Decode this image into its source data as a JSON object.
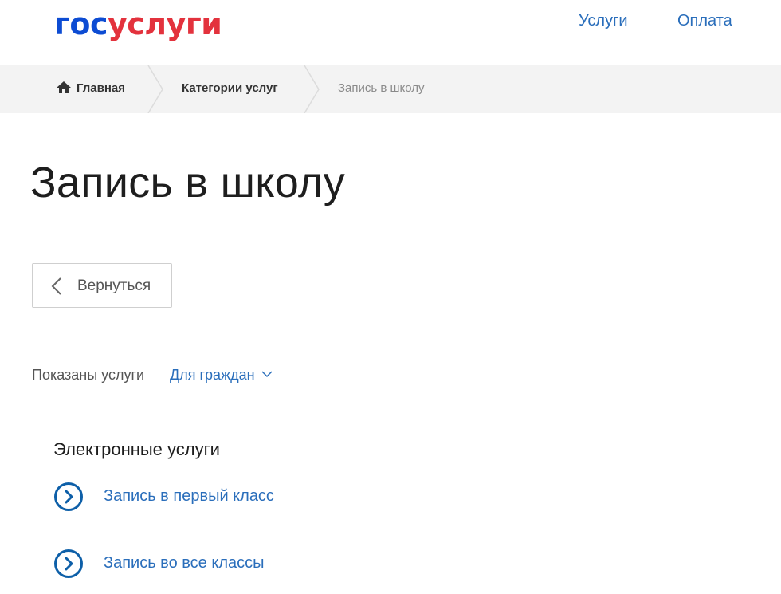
{
  "logo": {
    "part1": "гос",
    "part2": "услуги"
  },
  "top_nav": [
    {
      "label": "Услуги"
    },
    {
      "label": "Оплата"
    }
  ],
  "breadcrumbs": [
    {
      "label": "Главная",
      "icon": "home-icon"
    },
    {
      "label": "Категории услуг"
    },
    {
      "label": "Запись в школу"
    }
  ],
  "page_title": "Запись в школу",
  "back_button": {
    "label": "Вернуться",
    "icon": "chevron-left-icon"
  },
  "filter": {
    "label": "Показаны услуги",
    "selected": "Для граждан"
  },
  "section_title": "Электронные услуги",
  "services": [
    {
      "label": "Запись в первый класс",
      "icon": "circle-chevron-right-icon"
    },
    {
      "label": "Запись во все классы",
      "icon": "circle-chevron-right-icon"
    }
  ],
  "colors": {
    "brand_blue": "#0d4cd3",
    "brand_red": "#e3323d",
    "link": "#2a6ebb",
    "breadcrumb_bg": "#f3f3f3"
  }
}
